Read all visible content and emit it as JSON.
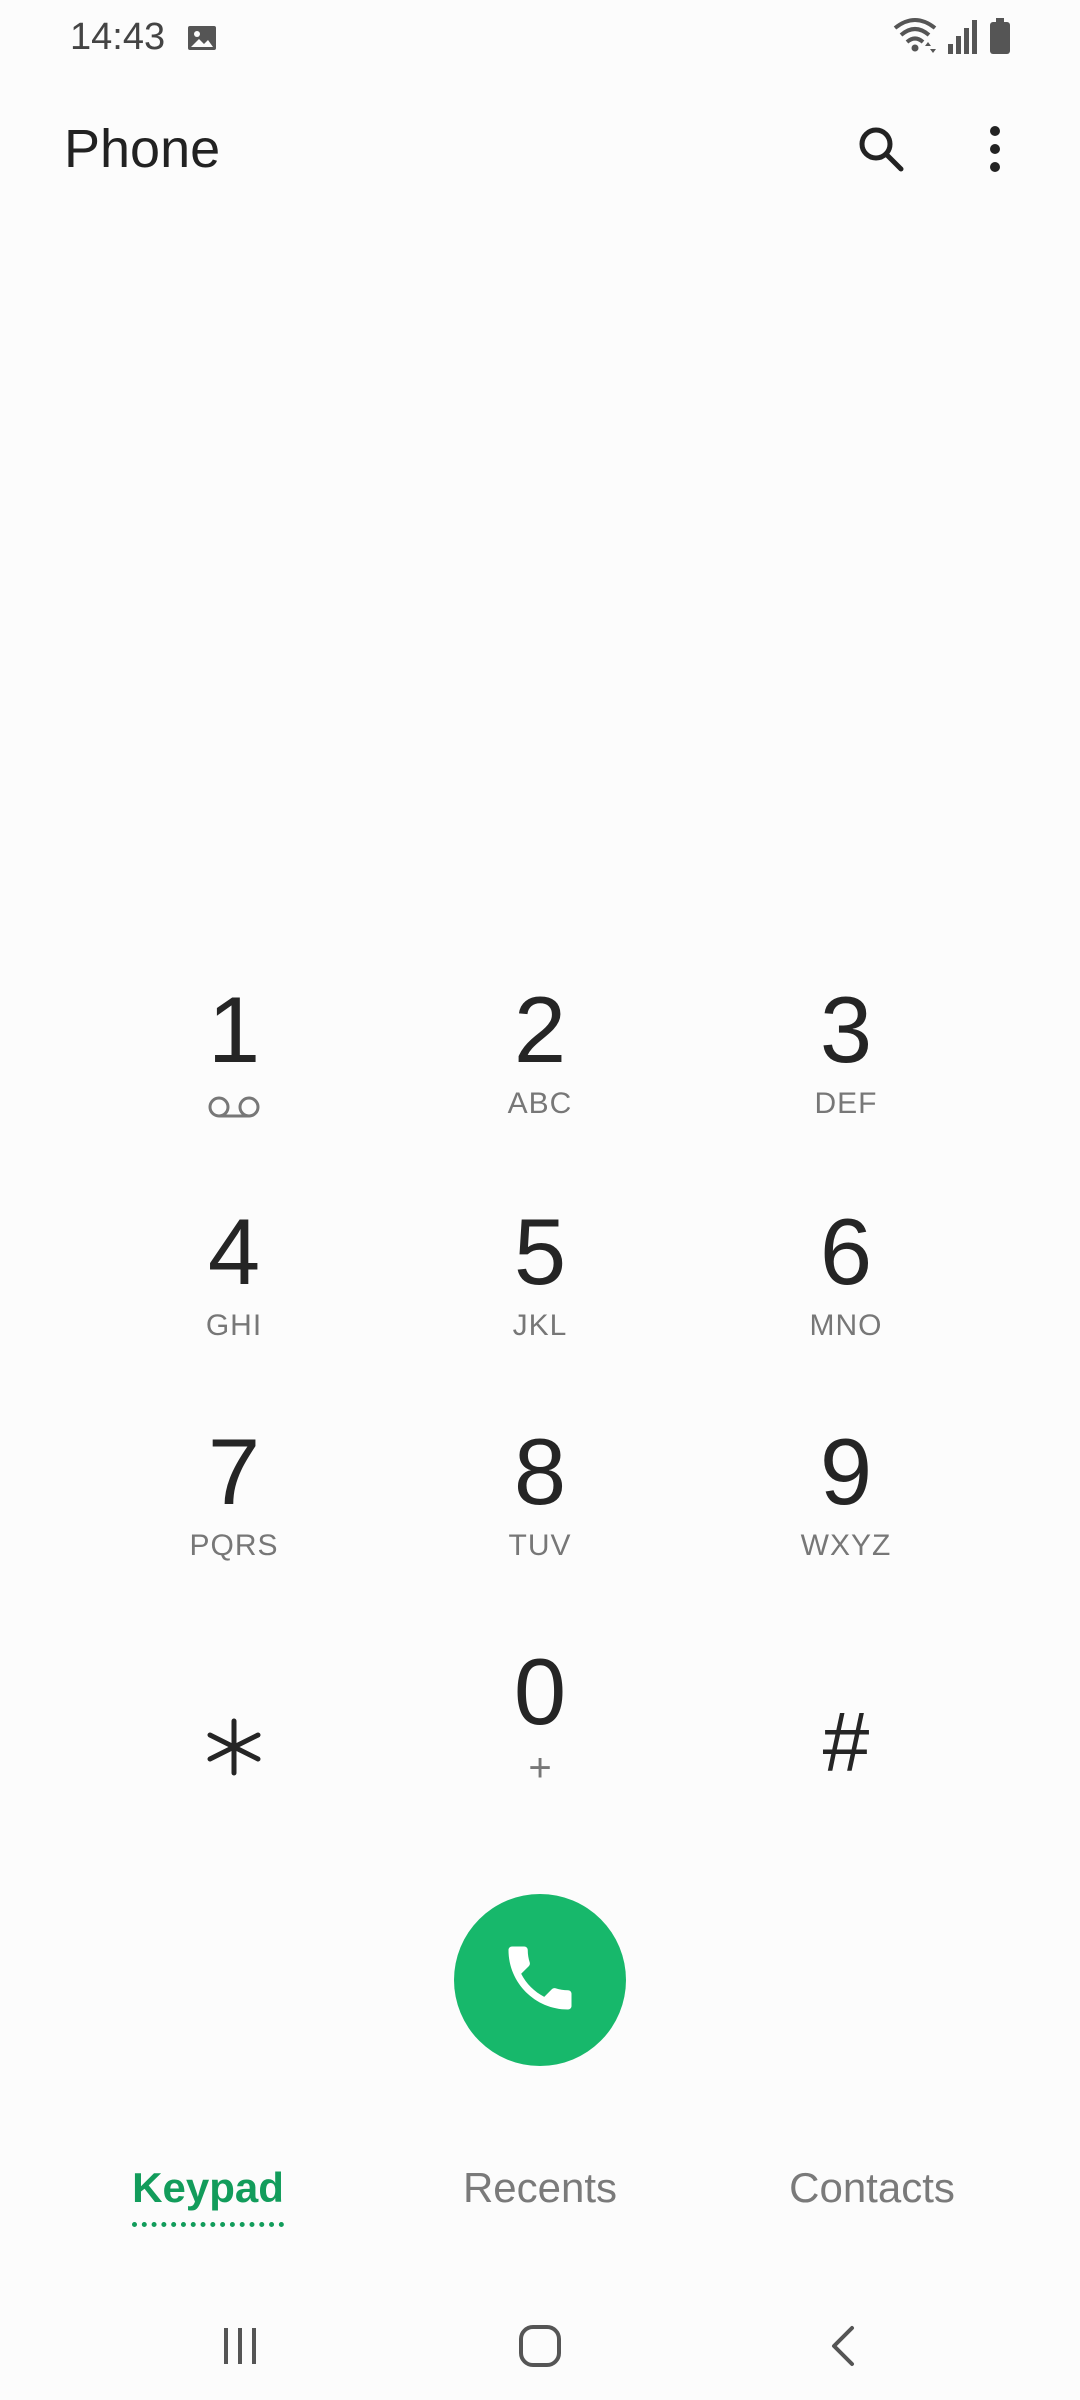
{
  "status_bar": {
    "time": "14:43",
    "icons": [
      "gallery-icon",
      "wifi-icon",
      "signal-icon",
      "battery-icon"
    ]
  },
  "app_bar": {
    "title": "Phone",
    "icons": [
      "search-icon",
      "more-vert-icon"
    ]
  },
  "keypad": {
    "keys": [
      {
        "digit": "1",
        "letters": "",
        "sub_icon": "voicemail-icon"
      },
      {
        "digit": "2",
        "letters": "ABC"
      },
      {
        "digit": "3",
        "letters": "DEF"
      },
      {
        "digit": "4",
        "letters": "GHI"
      },
      {
        "digit": "5",
        "letters": "JKL"
      },
      {
        "digit": "6",
        "letters": "MNO"
      },
      {
        "digit": "7",
        "letters": "PQRS"
      },
      {
        "digit": "8",
        "letters": "TUV"
      },
      {
        "digit": "9",
        "letters": "WXYZ"
      },
      {
        "digit": "*",
        "letters": ""
      },
      {
        "digit": "0",
        "letters": "+"
      },
      {
        "digit": "#",
        "letters": ""
      }
    ]
  },
  "call": {
    "icon": "phone-icon",
    "color": "#17b86b"
  },
  "tabs": [
    {
      "label": "Keypad",
      "active": true
    },
    {
      "label": "Recents",
      "active": false
    },
    {
      "label": "Contacts",
      "active": false
    }
  ],
  "colors": {
    "accent": "#129c5b",
    "call_green": "#17b86b"
  },
  "nav_bar": {
    "icons": [
      "recent-apps-icon",
      "home-icon",
      "back-icon"
    ]
  }
}
